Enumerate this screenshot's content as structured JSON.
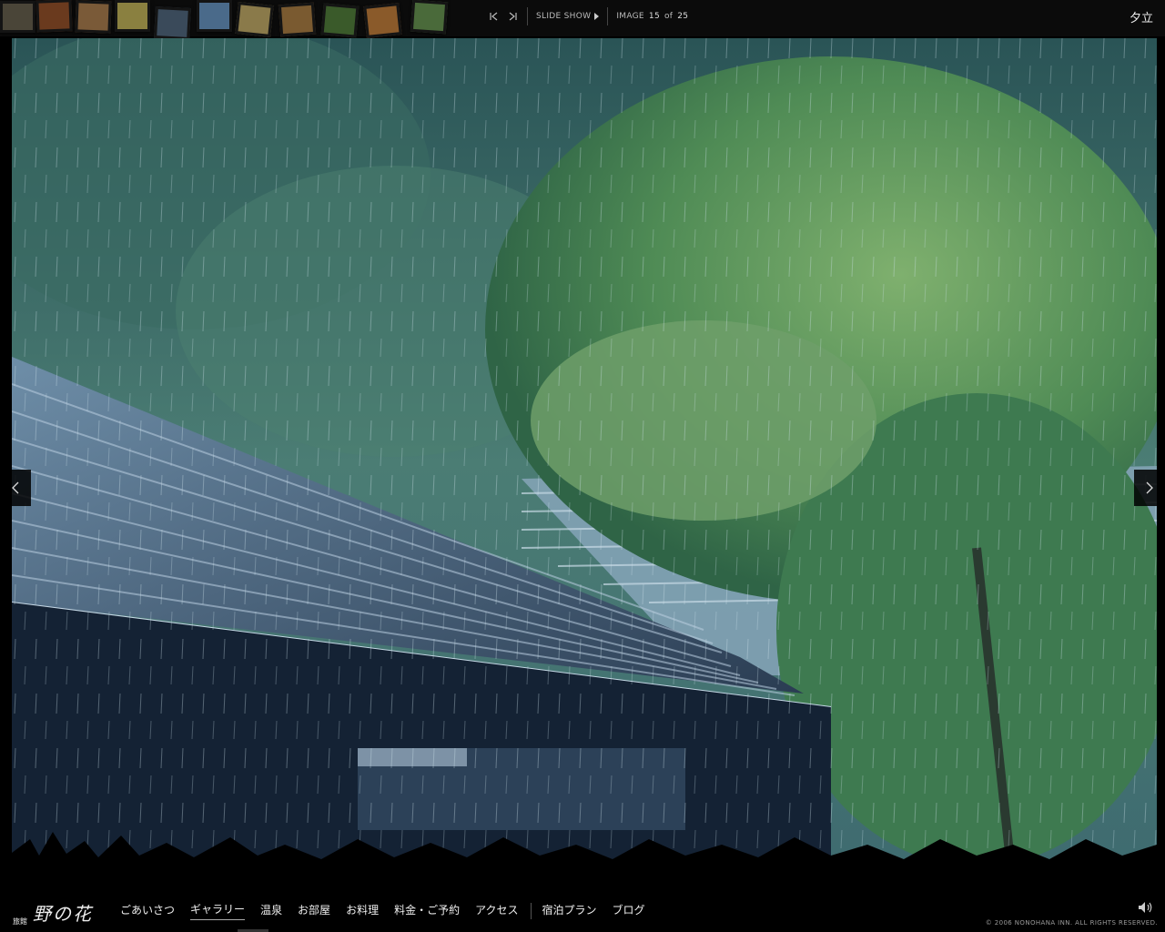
{
  "header": {
    "slideshow_label": "SLIDE SHOW",
    "image_label": "IMAGE",
    "current_index": "15",
    "of_label": "of",
    "total": "25",
    "photo_title": "夕立"
  },
  "thumbnails": [
    {
      "color": "#4a4538"
    },
    {
      "color": "#6a3a1e"
    },
    {
      "color": "#7a5a38"
    },
    {
      "color": "#8a8040"
    },
    {
      "color": "#3a4a5a"
    },
    {
      "color": "#4a6a8a"
    },
    {
      "color": "#8a7a4a"
    },
    {
      "color": "#7a5a30"
    },
    {
      "color": "#3a5a2a"
    },
    {
      "color": "#8a5a2a"
    },
    {
      "color": "#4a6a3a"
    }
  ],
  "icons": {
    "first": "first-image-icon",
    "last": "last-image-icon",
    "play": "play-icon",
    "prev": "chevron-left-icon",
    "next": "chevron-right-icon",
    "sound": "speaker-icon"
  },
  "footer": {
    "logo_small": "旅館",
    "logo_main": "野の花",
    "menu": [
      {
        "label": "ごあいさつ"
      },
      {
        "label": "ギャラリー",
        "active": true
      },
      {
        "label": "温泉"
      },
      {
        "label": "お部屋"
      },
      {
        "label": "お料理"
      },
      {
        "label": "料金・ご予約"
      },
      {
        "label": "アクセス"
      }
    ],
    "menu_extra": [
      {
        "label": "宿泊プラン"
      },
      {
        "label": "ブログ"
      }
    ],
    "copyright": "© 2006 NONOHANA INN. ALL RIGHTS RESERVED."
  },
  "colors": {
    "background": "#000000",
    "topbar": "#0b0b0b",
    "accent_text": "#eeeeee"
  }
}
